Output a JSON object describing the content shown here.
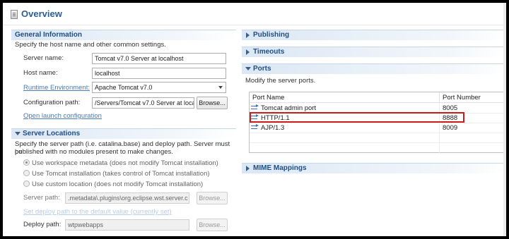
{
  "title": "Overview",
  "general": {
    "heading": "General Information",
    "description": "Specify the host name and other common settings.",
    "server_name_label": "Server name:",
    "server_name_value": "Tomcat v7.0 Server at localhost",
    "host_name_label": "Host name:",
    "host_name_value": "localhost",
    "runtime_label": "Runtime Environment:",
    "runtime_value": "Apache Tomcat v7.0",
    "config_label": "Configuration path:",
    "config_value": "/Servers/Tomcat v7.0 Server at loca",
    "browse_label": "Browse...",
    "open_launch_label": "Open launch configuration"
  },
  "locations": {
    "heading": "Server Locations",
    "description_line1": "Specify the server path (i.e. catalina.base) and deploy path. Server must be",
    "description_line2": "published with no modules present to make changes.",
    "radio1": "Use workspace metadata (does not modify Tomcat installation)",
    "radio2": "Use Tomcat installation (takes control of Tomcat installation)",
    "radio3": "Use custom location (does not modify Tomcat installation)",
    "server_path_label": "Server path:",
    "server_path_value": ".metadata\\.plugins\\org.eclipse.wst.server.c",
    "browse_label": "Browse...",
    "deploy_default_link": "Set deploy path to the default value (currently set)",
    "deploy_path_label": "Deploy path:",
    "deploy_path_value": "wtpwebapps",
    "browse2_label": "Browse..."
  },
  "right": {
    "publishing": "Publishing",
    "timeouts": "Timeouts",
    "ports_heading": "Ports",
    "ports_description": "Modify the server ports.",
    "table_header_name": "Port Name",
    "table_header_number": "Port Number",
    "rows": [
      {
        "name": "Tomcat admin port",
        "number": "8005"
      },
      {
        "name": "HTTP/1.1",
        "number": "8888"
      },
      {
        "name": "AJP/1.3",
        "number": "8009"
      }
    ],
    "mime": "MIME Mappings"
  },
  "colors": {
    "title": "#2b5f93",
    "section_header": "#1f4e84",
    "highlight_border": "#cc1d1d",
    "link": "#4d79b4"
  }
}
